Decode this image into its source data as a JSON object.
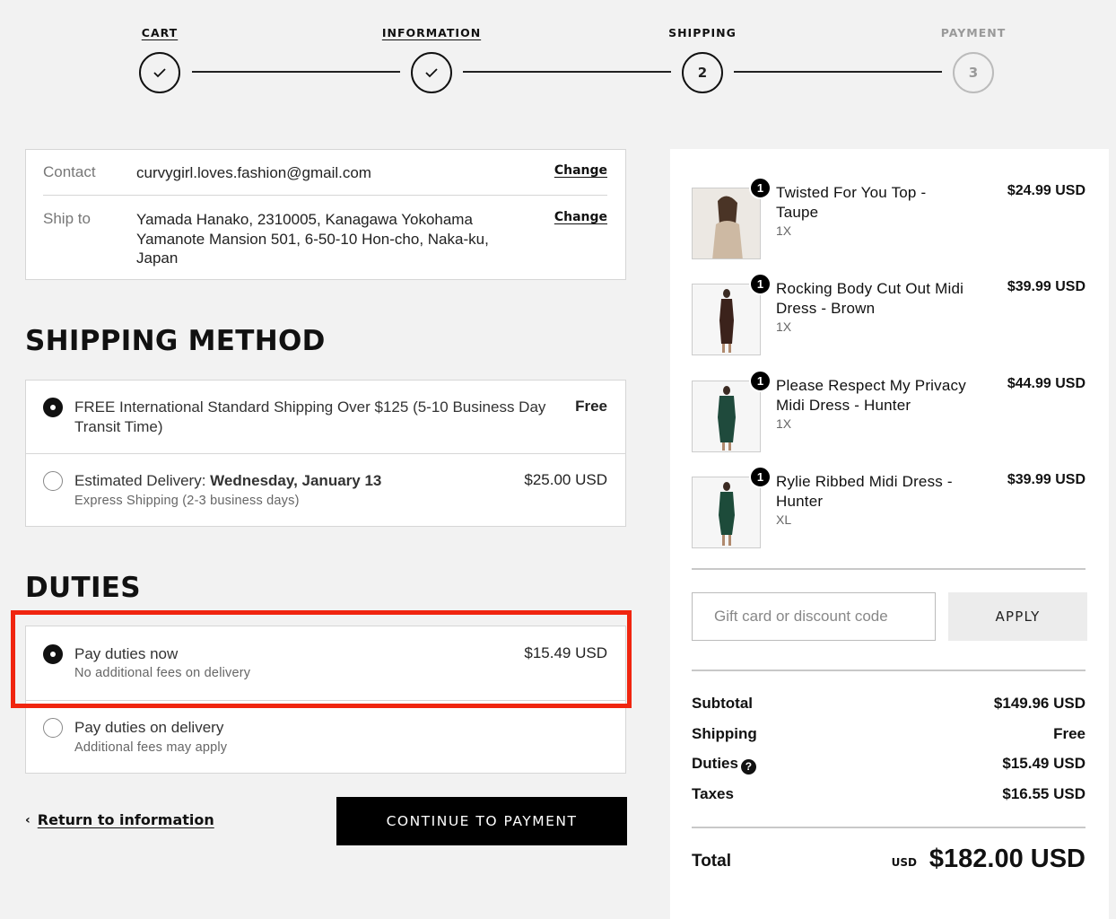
{
  "stepper": {
    "cart": "CART",
    "information": "INFORMATION",
    "shipping": "SHIPPING",
    "shipping_number": "2",
    "payment": "PAYMENT",
    "payment_number": "3"
  },
  "contact": {
    "label": "Contact",
    "value": "curvygirl.loves.fashion@gmail.com",
    "change": "Change"
  },
  "ship_to": {
    "label": "Ship to",
    "line1": "Yamada Hanako, 2310005, Kanagawa Yokohama",
    "line2": "Yamanote Mansion 501, 6-50-10 Hon-cho, Naka-ku,",
    "line3": "Japan",
    "change": "Change"
  },
  "shipping_method": {
    "title": "SHIPPING METHOD",
    "options": [
      {
        "line1": "FREE International Standard Shipping Over $125 (5-10 Business Day",
        "line2": "Transit Time)",
        "price": "Free",
        "selected": true
      },
      {
        "prefix": "Estimated Delivery: ",
        "date": "Wednesday, January 13",
        "sub": "Express Shipping (2-3 business days)",
        "price": "$25.00 USD",
        "selected": false
      }
    ]
  },
  "duties": {
    "title": "DUTIES",
    "options": [
      {
        "title": "Pay duties now",
        "sub": "No additional fees on delivery",
        "price": "$15.49 USD",
        "selected": true
      },
      {
        "title": "Pay duties on delivery",
        "sub": "Additional fees may apply",
        "selected": false
      }
    ]
  },
  "actions": {
    "return": "Return to information",
    "continue": "CONTINUE TO PAYMENT"
  },
  "cart_items": [
    {
      "qty": "1",
      "name1": "Twisted For You Top -",
      "name2": "Taupe",
      "variant": "1X",
      "price": "$24.99 USD",
      "color": "#cdb9a3"
    },
    {
      "qty": "1",
      "name1": "Rocking Body Cut Out Midi",
      "name2": "Dress - Brown",
      "variant": "1X",
      "price": "$39.99 USD",
      "color": "#3b221b"
    },
    {
      "qty": "1",
      "name1": "Please Respect My Privacy",
      "name2": "Midi Dress - Hunter",
      "variant": "1X",
      "price": "$44.99 USD",
      "color": "#1f4a3c"
    },
    {
      "qty": "1",
      "name1": "Rylie Ribbed Midi Dress -",
      "name2": "Hunter",
      "variant": "XL",
      "price": "$39.99 USD",
      "color": "#1d4b3a"
    }
  ],
  "discount": {
    "placeholder": "Gift card or discount code",
    "apply": "APPLY"
  },
  "totals": {
    "subtotal_label": "Subtotal",
    "subtotal": "$149.96 USD",
    "shipping_label": "Shipping",
    "shipping": "Free",
    "duties_label": "Duties",
    "duties": "$15.49 USD",
    "taxes_label": "Taxes",
    "taxes": "$16.55 USD",
    "total_label": "Total",
    "currency": "USD",
    "total": "$182.00 USD"
  },
  "colors": {
    "highlight": "#f0250f",
    "button": "#000000"
  }
}
